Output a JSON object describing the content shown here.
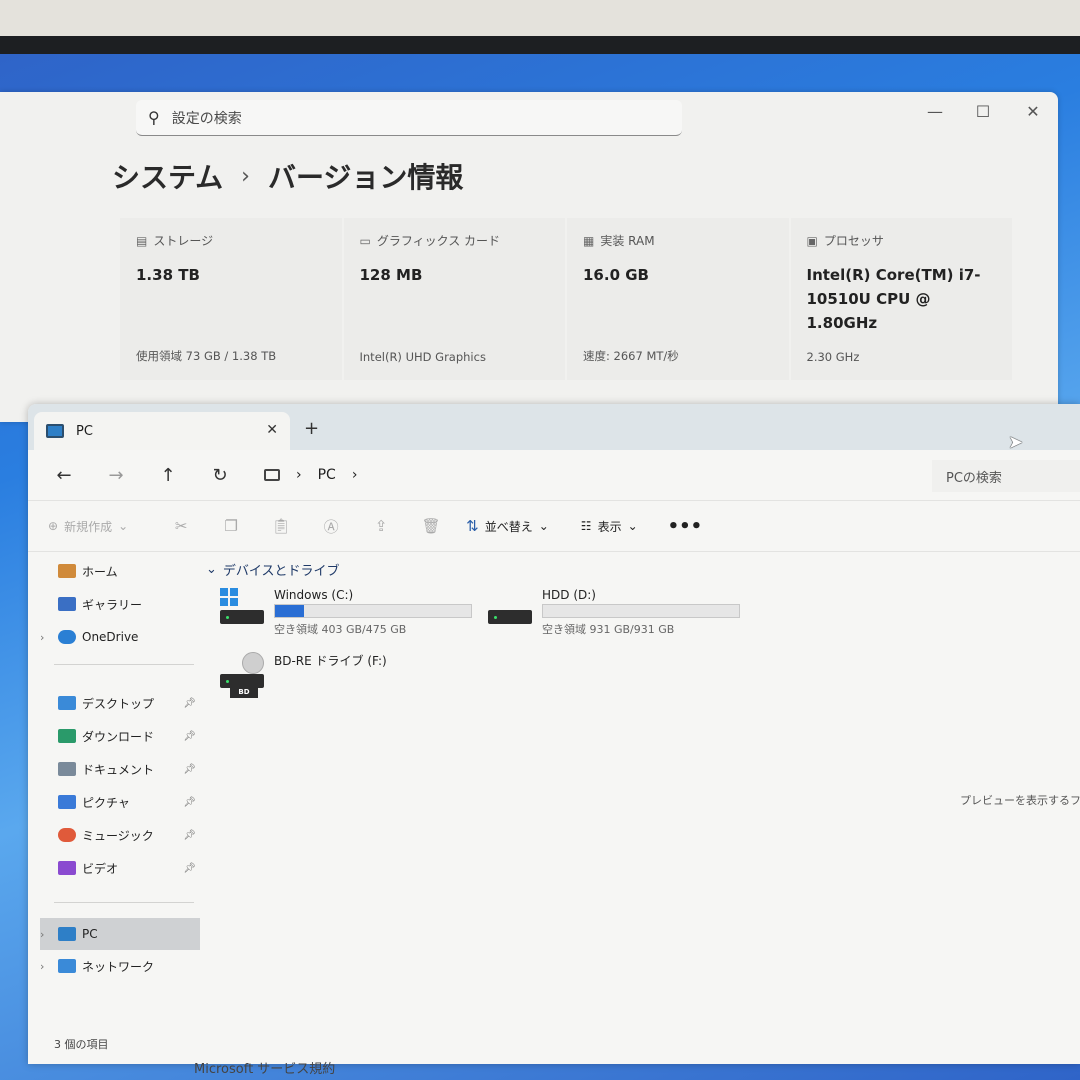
{
  "settings": {
    "search_placeholder": "設定の検索",
    "breadcrumb_parent": "システム",
    "breadcrumb_current": "バージョン情報",
    "window_controls": {
      "minimize": "—",
      "maximize": "☐",
      "close": "✕"
    },
    "cards": [
      {
        "label": "ストレージ",
        "value": "1.38 TB",
        "sub": "使用領域 73 GB / 1.38 TB",
        "icon": "storage-icon"
      },
      {
        "label": "グラフィックス カード",
        "value": "128 MB",
        "sub": "Intel(R) UHD Graphics",
        "icon": "graphics-card-icon"
      },
      {
        "label": "実装 RAM",
        "value": "16.0 GB",
        "sub": "速度: 2667 MT/秒",
        "icon": "ram-icon"
      },
      {
        "label": "プロセッサ",
        "value": "Intel(R) Core(TM) i7-10510U CPU @ 1.80GHz",
        "sub": "2.30 GHz",
        "icon": "processor-icon"
      }
    ]
  },
  "explorer": {
    "tab_title": "PC",
    "address": {
      "location": "PC"
    },
    "search_placeholder": "PCの検索",
    "commands": {
      "new": "新規作成",
      "sort": "並べ替え",
      "view": "表示",
      "more": "•••"
    },
    "sidebar": {
      "top": [
        {
          "label": "ホーム",
          "icon": "home-icon",
          "color": "#d08a3a"
        },
        {
          "label": "ギャラリー",
          "icon": "gallery-icon",
          "color": "#3a6fc4"
        },
        {
          "label": "OneDrive",
          "icon": "onedrive-icon",
          "color": "#2a7fd4"
        }
      ],
      "quick": [
        {
          "label": "デスクトップ",
          "icon": "desktop-icon",
          "color": "#3a8ad8"
        },
        {
          "label": "ダウンロード",
          "icon": "download-icon",
          "color": "#2a9a6a"
        },
        {
          "label": "ドキュメント",
          "icon": "documents-icon",
          "color": "#7a8a9a"
        },
        {
          "label": "ピクチャ",
          "icon": "pictures-icon",
          "color": "#3a7ad8"
        },
        {
          "label": "ミュージック",
          "icon": "music-icon",
          "color": "#e05a3a"
        },
        {
          "label": "ビデオ",
          "icon": "videos-icon",
          "color": "#8a4ad0"
        }
      ],
      "bottom": [
        {
          "label": "PC",
          "icon": "pc-icon",
          "color": "#2e7fc7"
        },
        {
          "label": "ネットワーク",
          "icon": "network-icon",
          "color": "#3a8ad8"
        }
      ]
    },
    "group_title": "デバイスとドライブ",
    "drives": [
      {
        "name": "Windows (C:)",
        "free": "空き領域 403 GB/475 GB",
        "used_fraction": 0.15
      },
      {
        "name": "HDD (D:)",
        "free": "空き領域 931 GB/931 GB",
        "used_fraction": 0.0
      },
      {
        "name": "BD-RE ドライブ (F:)"
      }
    ],
    "preview_text": "プレビューを表示するファイ",
    "status": "3 個の項目"
  },
  "footer_peek": "Microsoft サービス規約",
  "colors": {
    "accent": "#2a6ed4",
    "wallpaper": "#2a7ee0"
  }
}
